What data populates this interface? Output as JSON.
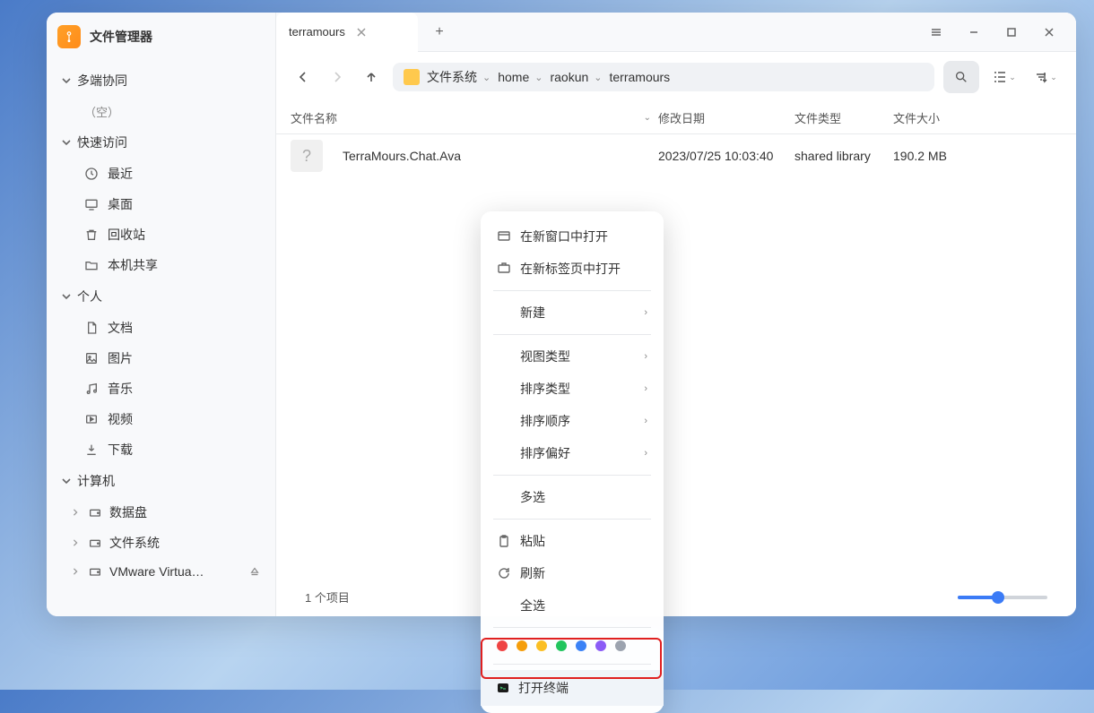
{
  "app": {
    "title": "文件管理器"
  },
  "sidebar": {
    "sections": {
      "sync": {
        "label": "多端协同",
        "empty": "（空）"
      },
      "quick": {
        "label": "快速访问",
        "items": [
          {
            "label": "最近"
          },
          {
            "label": "桌面"
          },
          {
            "label": "回收站"
          },
          {
            "label": "本机共享"
          }
        ]
      },
      "personal": {
        "label": "个人",
        "items": [
          {
            "label": "文档"
          },
          {
            "label": "图片"
          },
          {
            "label": "音乐"
          },
          {
            "label": "视频"
          },
          {
            "label": "下载"
          }
        ]
      },
      "computer": {
        "label": "计算机",
        "items": [
          {
            "label": "数据盘"
          },
          {
            "label": "文件系统"
          },
          {
            "label": "VMware Virtua…"
          }
        ]
      }
    }
  },
  "tab": {
    "title": "terramours"
  },
  "breadcrumb": {
    "root": "文件系统",
    "segments": [
      "home",
      "raokun",
      "terramours"
    ]
  },
  "columns": {
    "name": "文件名称",
    "date": "修改日期",
    "type": "文件类型",
    "size": "文件大小"
  },
  "files": [
    {
      "name": "TerraMours.Chat.Ava",
      "date": "2023/07/25 10:03:40",
      "type": "shared library",
      "size": "190.2 MB"
    }
  ],
  "status": {
    "count": "1 个项目"
  },
  "context_menu": {
    "open_new_window": "在新窗口中打开",
    "open_new_tab": "在新标签页中打开",
    "new": "新建",
    "view_type": "视图类型",
    "sort_type": "排序类型",
    "sort_order": "排序顺序",
    "sort_pref": "排序偏好",
    "multi_select": "多选",
    "paste": "粘贴",
    "refresh": "刷新",
    "select_all": "全选",
    "colors": [
      "#ef4444",
      "#f59e0b",
      "#fbbf24",
      "#22c55e",
      "#3b82f6",
      "#8b5cf6",
      "#9ca3af"
    ],
    "open_terminal": "打开终端"
  }
}
